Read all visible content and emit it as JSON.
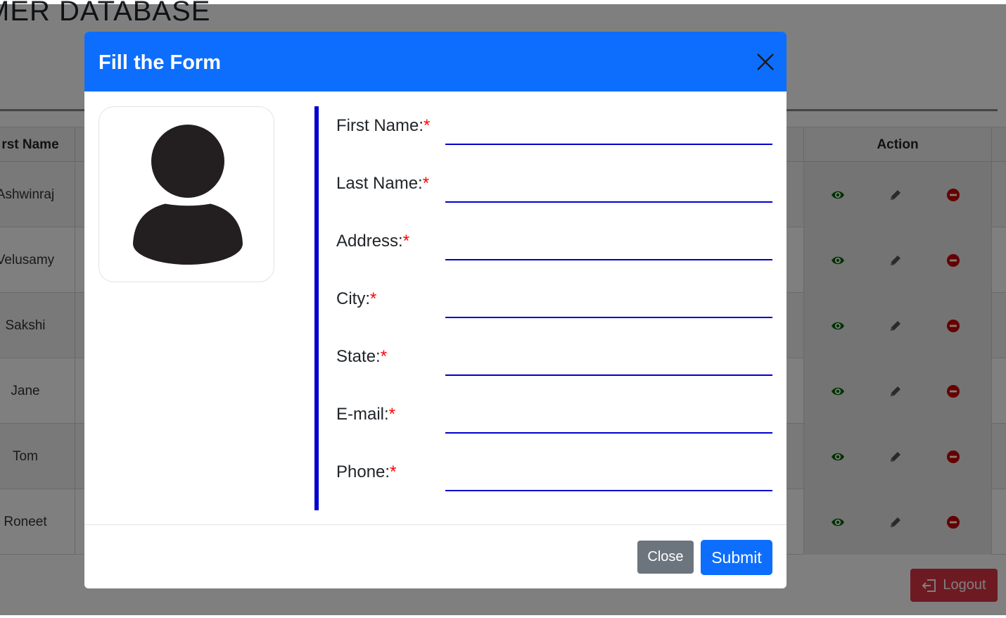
{
  "page": {
    "title": "MER DATABASE",
    "table": {
      "headers": {
        "first_name": "rst Name",
        "action": "Action"
      },
      "rows": [
        {
          "first_name": "Ashwinraj"
        },
        {
          "first_name": "Velusamy"
        },
        {
          "first_name": "Sakshi"
        },
        {
          "first_name": "Jane"
        },
        {
          "first_name": "Tom"
        },
        {
          "first_name": "Roneet"
        }
      ],
      "action_icons": [
        "eye-icon",
        "pencil-icon",
        "minus-circle-icon"
      ],
      "colors": {
        "view": "#006400",
        "edit": "#555555",
        "delete": "#cc0000"
      }
    },
    "logout_label": "Logout"
  },
  "modal": {
    "title": "Fill the Form",
    "header_color": "#0d6efd",
    "avatar_icon": "user-avatar-icon",
    "fields": [
      {
        "label": "First Name:",
        "required_mark": "*",
        "value": ""
      },
      {
        "label": "Last Name:",
        "required_mark": "*",
        "value": ""
      },
      {
        "label": "Address:",
        "required_mark": "*",
        "value": ""
      },
      {
        "label": "City:",
        "required_mark": "*",
        "value": ""
      },
      {
        "label": "State:",
        "required_mark": "*",
        "value": ""
      },
      {
        "label": "E-mail:",
        "required_mark": "*",
        "value": ""
      },
      {
        "label": "Phone:",
        "required_mark": "*",
        "value": ""
      }
    ],
    "buttons": {
      "close": "Close",
      "submit": "Submit"
    }
  }
}
